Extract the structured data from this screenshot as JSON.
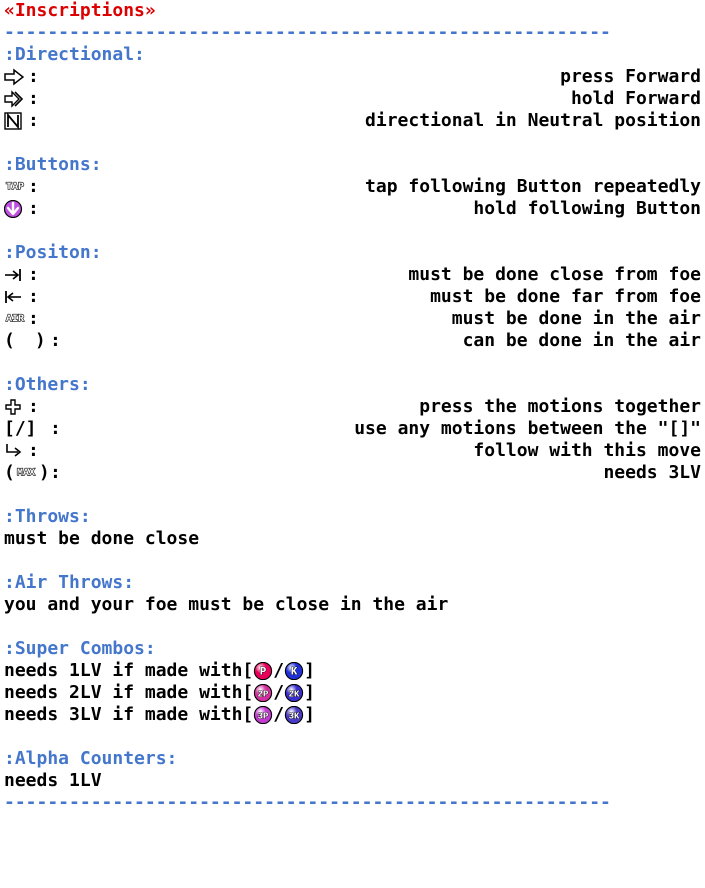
{
  "title": "«Inscriptions»",
  "hr": "--------------------------------------------------------",
  "sections": {
    "directional": {
      "header": ":Directional:",
      "items": [
        {
          "icon": "arrow-right-outline",
          "desc": "press Forward"
        },
        {
          "icon": "arrow-right-double",
          "desc": "hold Forward"
        },
        {
          "icon": "neutral-n",
          "desc": "directional in Neutral position"
        }
      ]
    },
    "buttons": {
      "header": ":Buttons:",
      "items": [
        {
          "icon": "tap-label",
          "desc": "tap following Button repeatedly"
        },
        {
          "icon": "hold-arrow-down-purple",
          "desc": "hold following Button"
        }
      ]
    },
    "position": {
      "header": ":Positon:",
      "items": [
        {
          "icon": "close-range",
          "desc": "must be done close from foe"
        },
        {
          "icon": "far-range",
          "desc": "must be done far from foe"
        },
        {
          "icon": "air-label",
          "desc": "must be done in the air"
        },
        {
          "icon": "air-optional",
          "desc": "can be done in the air",
          "iconPrefix": "(",
          "iconSuffix": ")"
        }
      ]
    },
    "others": {
      "header": ":Others:",
      "items": [
        {
          "icon": "plus-outline",
          "desc": "press the motions together"
        },
        {
          "textIcon": "[/]",
          "desc": "use any motions between the \"[]\""
        },
        {
          "icon": "follow-arrow",
          "desc": "follow with this move"
        },
        {
          "icon": "max-label",
          "desc": "needs 3LV",
          "iconPrefix": "(",
          "iconSuffix": ")"
        }
      ]
    },
    "throws": {
      "header": ":Throws:",
      "note": "must be done close"
    },
    "airThrows": {
      "header": ":Air Throws:",
      "note": "you and your foe must be close in the air"
    },
    "superCombos": {
      "header": ":Super Combos:",
      "lines": [
        {
          "pre": "needs 1LV if made with[",
          "a": {
            "t": "P",
            "c": "#e8005a"
          },
          "sep": "/",
          "b": {
            "t": "K",
            "c": "#2030d8"
          },
          "post": "]"
        },
        {
          "pre": "needs 2LV if made with[",
          "a": {
            "t": "2P",
            "c": "#d42ea0"
          },
          "sep": "/",
          "b": {
            "t": "2K",
            "c": "#3a2dd0"
          },
          "post": "]"
        },
        {
          "pre": "needs 3LV if made with[",
          "a": {
            "t": "3P",
            "c": "#c23ad0"
          },
          "sep": "/",
          "b": {
            "t": "3K",
            "c": "#4a3ac8"
          },
          "post": "]"
        }
      ]
    },
    "alphaCounters": {
      "header": ":Alpha Counters:",
      "note": "needs 1LV"
    }
  }
}
